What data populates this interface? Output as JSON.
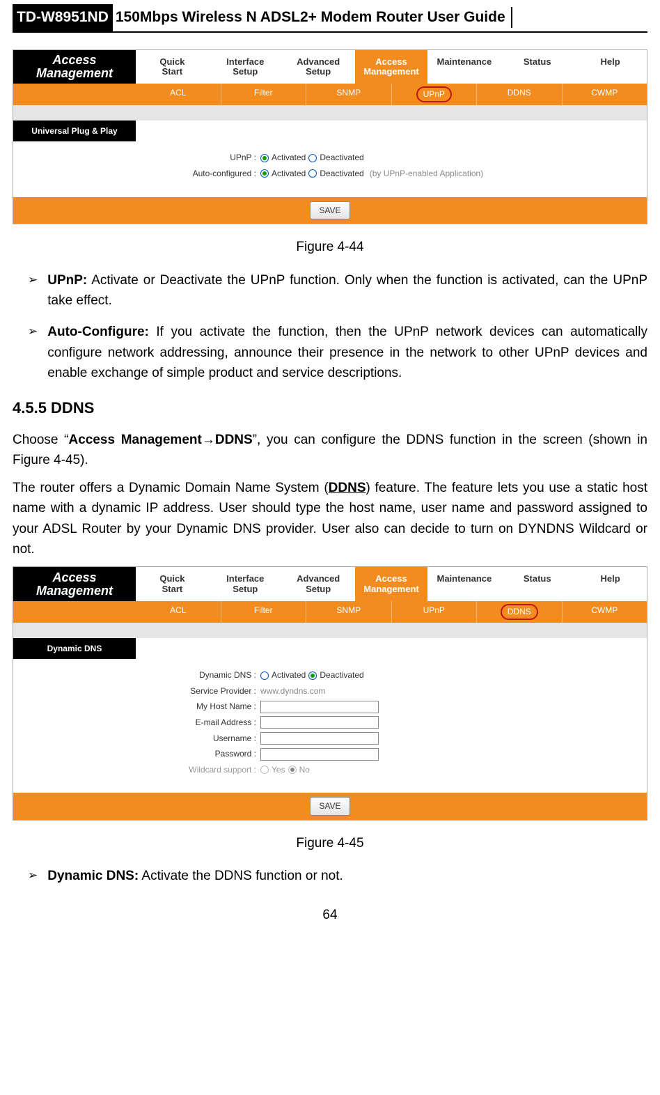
{
  "header": {
    "model": "TD-W8951ND",
    "title": "150Mbps Wireless N ADSL2+ Modem Router User Guide"
  },
  "fig1": {
    "brand": "Access Management",
    "tabs": [
      "Quick Start",
      "Interface Setup",
      "Advanced Setup",
      "Access Management",
      "Maintenance",
      "Status",
      "Help"
    ],
    "active_tab": "Access Management",
    "subtabs": [
      "ACL",
      "Filter",
      "SNMP",
      "UPnP",
      "DDNS",
      "CWMP"
    ],
    "active_subtab": "UPnP",
    "section_title": "Universal Plug & Play",
    "rows": {
      "upnp_label": "UPnP :",
      "upnp_opt1": "Activated",
      "upnp_opt2": "Deactivated",
      "auto_label": "Auto-configured :",
      "auto_opt1": "Activated",
      "auto_opt2": "Deactivated",
      "auto_note": "(by UPnP-enabled Application)"
    },
    "save": "SAVE",
    "caption": "Figure 4-44"
  },
  "bullets1": {
    "b1_bold": "UPnP:",
    "b1_text": " Activate or Deactivate the UPnP function. Only when the function is activated, can the UPnP take effect.",
    "b2_bold": "Auto-Configure:",
    "b2_text": " If you activate the function, then the UPnP network devices can automatically configure network addressing, announce their presence in the network to other UPnP devices and enable exchange of simple product and service descriptions."
  },
  "section455": {
    "heading": "4.5.5  DDNS",
    "p1_a": "Choose “",
    "p1_b": "Access Management",
    "p1_c": "→",
    "p1_d": "DDNS",
    "p1_e": "”, you can configure the DDNS function in the screen (shown in Figure 4-45).",
    "p2_a": "The router offers a Dynamic Domain Name System (",
    "p2_b": "DDNS",
    "p2_c": ") feature. The feature lets you use a static host name with a dynamic IP address. User should type the host name, user name and password assigned to your ADSL Router by your Dynamic DNS provider. User also can decide to turn on DYNDNS Wildcard or not."
  },
  "fig2": {
    "brand": "Access Management",
    "tabs": [
      "Quick Start",
      "Interface Setup",
      "Advanced Setup",
      "Access Management",
      "Maintenance",
      "Status",
      "Help"
    ],
    "active_tab": "Access Management",
    "subtabs": [
      "ACL",
      "Filter",
      "SNMP",
      "UPnP",
      "DDNS",
      "CWMP"
    ],
    "active_subtab": "DDNS",
    "section_title": "Dynamic DNS",
    "rows": {
      "ddns_label": "Dynamic DNS :",
      "ddns_opt1": "Activated",
      "ddns_opt2": "Deactivated",
      "provider_label": "Service Provider :",
      "provider_value": "www.dyndns.com",
      "host_label": "My Host Name :",
      "email_label": "E-mail Address :",
      "user_label": "Username :",
      "pass_label": "Password :",
      "wildcard_label": "Wildcard support :",
      "wildcard_opt1": "Yes",
      "wildcard_opt2": "No"
    },
    "save": "SAVE",
    "caption": "Figure 4-45"
  },
  "bullets2": {
    "b1_bold": "Dynamic DNS:",
    "b1_text": " Activate the DDNS function or not."
  },
  "page_number": "64"
}
